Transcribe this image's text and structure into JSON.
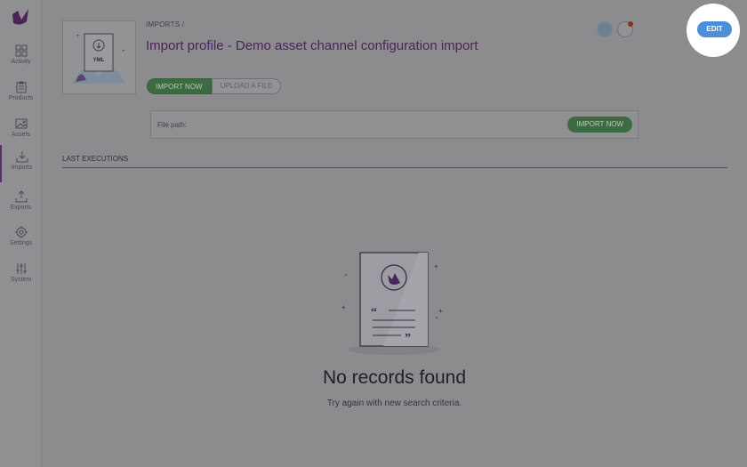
{
  "sidebar": {
    "items": [
      {
        "label": "Activity",
        "icon": "grid-icon"
      },
      {
        "label": "Products",
        "icon": "clipboard-icon"
      },
      {
        "label": "Assets",
        "icon": "image-icon"
      },
      {
        "label": "Imports",
        "icon": "import-icon",
        "active": true
      },
      {
        "label": "Exports",
        "icon": "export-icon"
      },
      {
        "label": "Settings",
        "icon": "gear-icon"
      },
      {
        "label": "System",
        "icon": "sliders-icon"
      }
    ]
  },
  "header": {
    "breadcrumb": "IMPORTS /",
    "title": "Import profile - Demo asset channel configuration import",
    "edit_label": "EDIT"
  },
  "thumbnail": {
    "file_label": "YML"
  },
  "actions": {
    "import_now": "IMPORT NOW",
    "upload_file": "UPLOAD A FILE"
  },
  "path": {
    "label": "File path:",
    "button": "IMPORT NOW"
  },
  "executions": {
    "title": "LAST EXECUTIONS"
  },
  "empty": {
    "title": "No records found",
    "subtitle": "Try again with new search criteria."
  },
  "colors": {
    "brand": "#5a2f6b",
    "accent_green": "#3c6b42",
    "edit_blue": "#4a8fd8"
  }
}
